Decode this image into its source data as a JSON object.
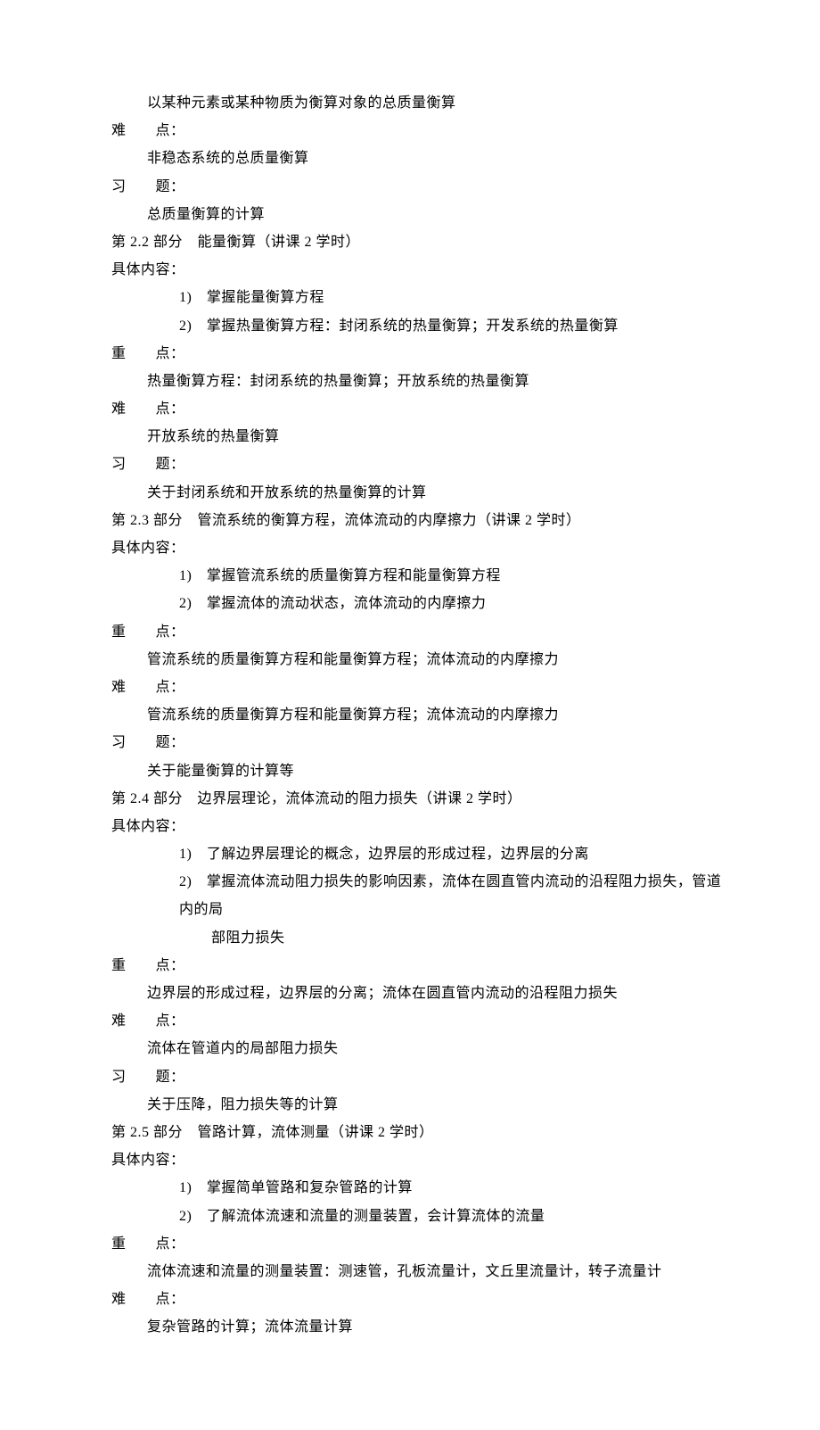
{
  "lines": [
    {
      "cls": "indent1",
      "text": "以某种元素或某种物质为衡算对象的总质量衡算"
    },
    {
      "cls": "",
      "text": "难　　点："
    },
    {
      "cls": "indent1",
      "text": "非稳态系统的总质量衡算"
    },
    {
      "cls": "",
      "text": "习　　题："
    },
    {
      "cls": "indent1",
      "text": "总质量衡算的计算"
    },
    {
      "cls": "",
      "text": "第 2.2 部分　能量衡算（讲课 2 学时）"
    },
    {
      "cls": "",
      "text": "具体内容："
    },
    {
      "cls": "indent2",
      "text": "1)　掌握能量衡算方程"
    },
    {
      "cls": "indent2",
      "text": "2)　掌握热量衡算方程：封闭系统的热量衡算；开发系统的热量衡算"
    },
    {
      "cls": "",
      "text": "重　　点："
    },
    {
      "cls": "indent1",
      "text": "热量衡算方程：封闭系统的热量衡算；开放系统的热量衡算"
    },
    {
      "cls": "",
      "text": "难　　点："
    },
    {
      "cls": "indent1",
      "text": "开放系统的热量衡算"
    },
    {
      "cls": "",
      "text": "习　　题："
    },
    {
      "cls": "indent1",
      "text": "关于封闭系统和开放系统的热量衡算的计算"
    },
    {
      "cls": "",
      "text": "第 2.3 部分　管流系统的衡算方程，流体流动的内摩擦力（讲课 2 学时）"
    },
    {
      "cls": "",
      "text": "具体内容："
    },
    {
      "cls": "indent2",
      "text": "1)　掌握管流系统的质量衡算方程和能量衡算方程"
    },
    {
      "cls": "indent2",
      "text": "2)　掌握流体的流动状态，流体流动的内摩擦力"
    },
    {
      "cls": "",
      "text": "重　　点："
    },
    {
      "cls": "indent1",
      "text": "管流系统的质量衡算方程和能量衡算方程；流体流动的内摩擦力"
    },
    {
      "cls": "",
      "text": "难　　点："
    },
    {
      "cls": "indent1",
      "text": "管流系统的质量衡算方程和能量衡算方程；流体流动的内摩擦力"
    },
    {
      "cls": "",
      "text": "习　　题："
    },
    {
      "cls": "indent1",
      "text": "关于能量衡算的计算等"
    },
    {
      "cls": "",
      "text": "第 2.4 部分　边界层理论，流体流动的阻力损失（讲课 2 学时）"
    },
    {
      "cls": "",
      "text": "具体内容："
    },
    {
      "cls": "indent2",
      "text": "1)　了解边界层理论的概念，边界层的形成过程，边界层的分离"
    },
    {
      "cls": "indent2",
      "text": "2)　掌握流体流动阻力损失的影响因素，流体在圆直管内流动的沿程阻力损失，管道内的局"
    },
    {
      "cls": "indent2b",
      "text": "部阻力损失"
    },
    {
      "cls": "",
      "text": "重　　点："
    },
    {
      "cls": "indent1",
      "text": "边界层的形成过程，边界层的分离；流体在圆直管内流动的沿程阻力损失"
    },
    {
      "cls": "",
      "text": "难　　点："
    },
    {
      "cls": "indent1",
      "text": "流体在管道内的局部阻力损失"
    },
    {
      "cls": "",
      "text": "习　　题："
    },
    {
      "cls": "indent1",
      "text": "关于压降，阻力损失等的计算"
    },
    {
      "cls": "",
      "text": "第 2.5 部分　管路计算，流体测量（讲课 2 学时）"
    },
    {
      "cls": "",
      "text": "具体内容："
    },
    {
      "cls": "indent2",
      "text": "1)　掌握简单管路和复杂管路的计算"
    },
    {
      "cls": "indent2",
      "text": "2)　了解流体流速和流量的测量装置，会计算流体的流量"
    },
    {
      "cls": "",
      "text": "重　　点："
    },
    {
      "cls": "indent1",
      "text": "流体流速和流量的测量装置：测速管，孔板流量计，文丘里流量计，转子流量计"
    },
    {
      "cls": "",
      "text": "难　　点："
    },
    {
      "cls": "indent1",
      "text": "复杂管路的计算；流体流量计算"
    }
  ]
}
